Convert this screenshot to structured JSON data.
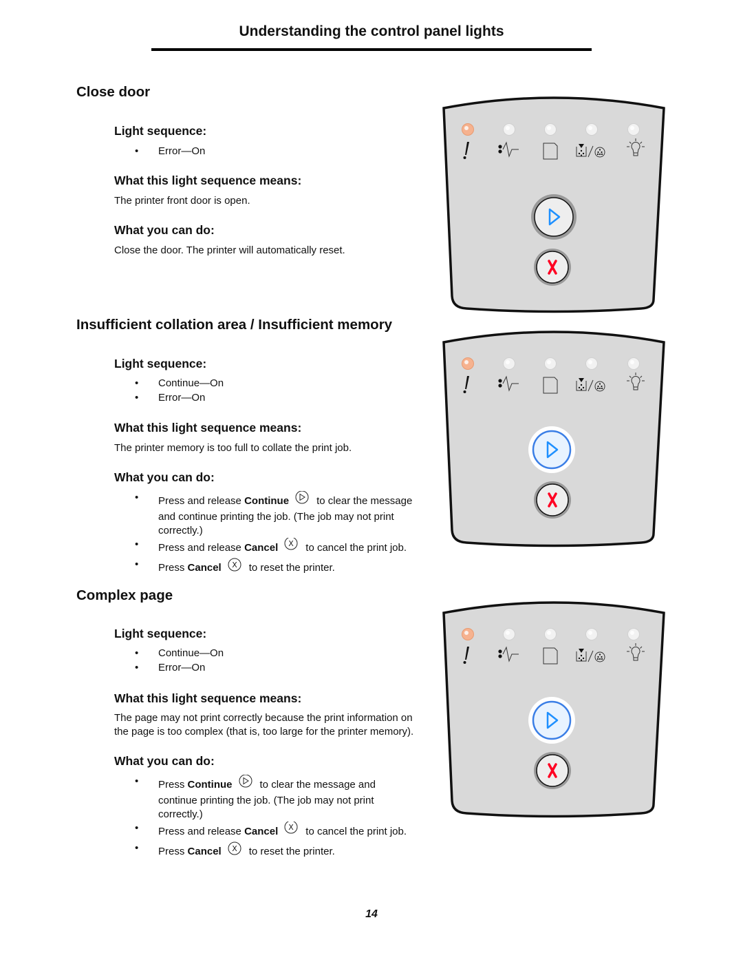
{
  "header": {
    "title": "Understanding the control panel lights"
  },
  "page_number": "14",
  "labels": {
    "light_sequence": "Light sequence:",
    "means": "What this light sequence means:",
    "what_you_can_do": "What you can do:",
    "bullet": "•"
  },
  "panel": {
    "lights": [
      {
        "name": "Error",
        "icon": "exclamation-icon"
      },
      {
        "name": "Paper jam",
        "icon": "paper-jam-icon"
      },
      {
        "name": "Load paper",
        "icon": "paper-icon"
      },
      {
        "name": "Toner low / Replace photoconductor",
        "icon": "toner-photoconductor-icon"
      },
      {
        "name": "Ready",
        "icon": "light-bulb-icon"
      }
    ],
    "colors": {
      "body": "#d9d9d9",
      "led_on": "#f6b28f",
      "led_off": "#f2f2f2",
      "continue_arrow": "#1e90ff",
      "continue_lit_ring": "#3a7ee6",
      "cancel_x": "#ff0022"
    }
  },
  "sections": [
    {
      "title": "Close door",
      "light_sequence": [
        "Error—On"
      ],
      "means": "The printer front door is open.",
      "action_text": "Close the door. The printer will automatically reset.",
      "panel_state": {
        "error_led": "on",
        "continue_lit": false
      }
    },
    {
      "title": "Insufficient collation area / Insufficient memory",
      "light_sequence": [
        "Continue—On",
        "Error—On"
      ],
      "means": "The printer memory is too full to collate the print job.",
      "actions": [
        {
          "pre": "Press and release ",
          "bold": "Continue",
          "icon": "continue-icon",
          "post": "to clear the message",
          "cont1": "and continue printing the job. (The job may not print",
          "cont2": "correctly.)"
        },
        {
          "pre": "Press and release ",
          "bold": "Cancel",
          "icon": "cancel-icon",
          "post": "to cancel the print job."
        },
        {
          "pre": "Press ",
          "bold": "Cancel",
          "icon": "cancel-icon",
          "post": "to reset the printer."
        }
      ],
      "panel_state": {
        "error_led": "on",
        "continue_lit": true
      }
    },
    {
      "title": "Complex page",
      "light_sequence": [
        "Continue—On",
        "Error—On"
      ],
      "means_line1": "The page may not print correctly because the print information on",
      "means_line2": "the page is too complex (that is, too large for the printer memory).",
      "actions": [
        {
          "pre": "Press ",
          "bold": "Continue",
          "icon": "continue-icon",
          "post": "to clear the message and",
          "cont1": "continue printing the job. (The job may not print",
          "cont2": "correctly.)"
        },
        {
          "pre": "Press and release ",
          "bold": "Cancel",
          "icon": "cancel-icon",
          "post": "to cancel the print job."
        },
        {
          "pre": "Press ",
          "bold": "Cancel",
          "icon": "cancel-icon",
          "post": "to reset the printer."
        }
      ],
      "panel_state": {
        "error_led": "on",
        "continue_lit": true
      }
    }
  ]
}
